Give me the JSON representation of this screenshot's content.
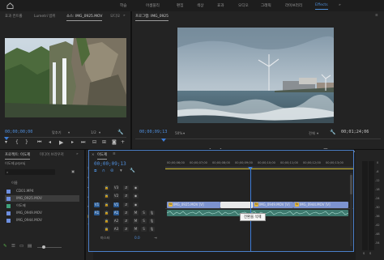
{
  "workspaces": [
    "학습",
    "어셈블리",
    "편집",
    "색상",
    "효과",
    "오디오",
    "그래픽",
    "라이브러리",
    "Effects"
  ],
  "active_workspace": "Effects",
  "source": {
    "tabs": [
      "효과 컨트롤",
      "Lumetri 범위",
      "소스: IMG_0925.MOV",
      "오디오"
    ],
    "timecode_in": "00;00;00;00",
    "fit": "맞추기",
    "resolution": "1/2"
  },
  "program": {
    "title": "프로그램: IMG_0925",
    "timecode": "00;00;09;13",
    "zoom": "50%",
    "resolution": "전체",
    "duration": "00;01;24;06"
  },
  "project": {
    "title": "프로젝트: 이도제",
    "tab2": "미디어 브라우저",
    "file": "이도제.prproj",
    "name_header": "이름",
    "items": [
      {
        "name": "CD01.MP4",
        "color": "#6d8fe0",
        "selected": false
      },
      {
        "name": "IMG_0925.MOV",
        "color": "#6d8fe0",
        "selected": true
      },
      {
        "name": "이도제",
        "color": "#3ea07b",
        "selected": false
      },
      {
        "name": "IMG_0949.MOV",
        "color": "#6d8fe0",
        "selected": false
      },
      {
        "name": "IMG_0944.MOV",
        "color": "#6d8fe0",
        "selected": false
      }
    ]
  },
  "timeline": {
    "title": "이도제",
    "timecode": "00;00;09;13",
    "ruler": [
      "00;00;06;00",
      "00;00;07;00",
      "00;00;08;00",
      "00;00;09;00",
      "00;00;10;00",
      "00;00;11;00",
      "00;00;12;00",
      "00;00;13;00"
    ],
    "tracks": [
      {
        "id": "V3",
        "target": "",
        "audio": false
      },
      {
        "id": "V2",
        "target": "",
        "audio": false
      },
      {
        "id": "V1",
        "target": "V1",
        "audio": false
      },
      {
        "id": "A1",
        "target": "A1",
        "audio": true
      },
      {
        "id": "A2",
        "target": "",
        "audio": true
      },
      {
        "id": "A3",
        "target": "",
        "audio": true
      }
    ],
    "master": "마스터",
    "master_value": "0.0",
    "clips": [
      {
        "label": "IMG_0925.MOV [V]"
      },
      {
        "label": "IMG_0949.MOV [V]"
      },
      {
        "label": "IMG_0944.MOV [V]"
      }
    ],
    "tooltip": "전환을 삭제"
  },
  "meter": {
    "labels": [
      "0",
      "-6",
      "-12",
      "-18",
      "-24",
      "-30",
      "-36",
      "-42",
      "-48",
      "-54"
    ],
    "bottom": [
      "S",
      "S"
    ]
  }
}
